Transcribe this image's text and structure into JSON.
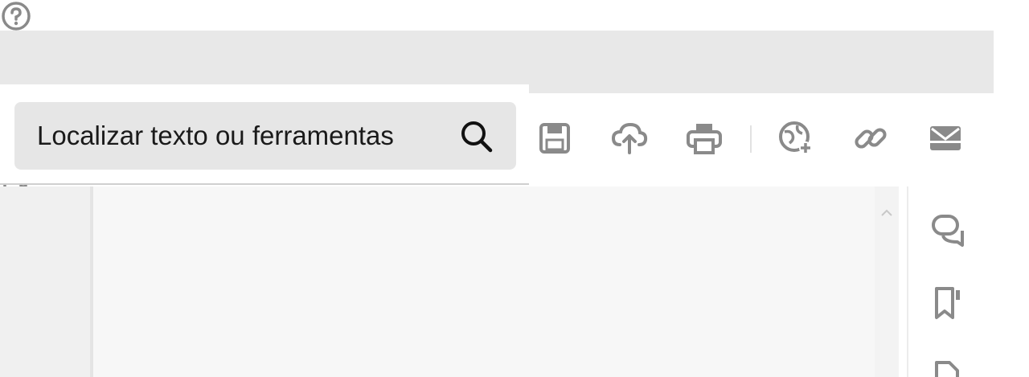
{
  "search": {
    "placeholder": "Localizar texto ou ferramentas"
  },
  "titlebar": {
    "icons": [
      "help-icon",
      "notifications-icon",
      "apps-grid-icon",
      "user-avatar",
      "minimize-icon",
      "restore-icon",
      "close-icon"
    ]
  },
  "toolbar": {
    "icons": [
      "save-icon",
      "cloud-upload-icon",
      "print-icon",
      "share-globe-icon",
      "link-icon",
      "email-icon"
    ]
  },
  "right_rail": {
    "icons": [
      "comment-icon",
      "bookmark-icon",
      "attachment-icon"
    ]
  },
  "colors": {
    "titlebar_bg": "#e8e8e8",
    "icon_gray": "#8a8a8a",
    "avatar_green": "#5db32c",
    "avatar_blue": "#2a6fb5"
  }
}
